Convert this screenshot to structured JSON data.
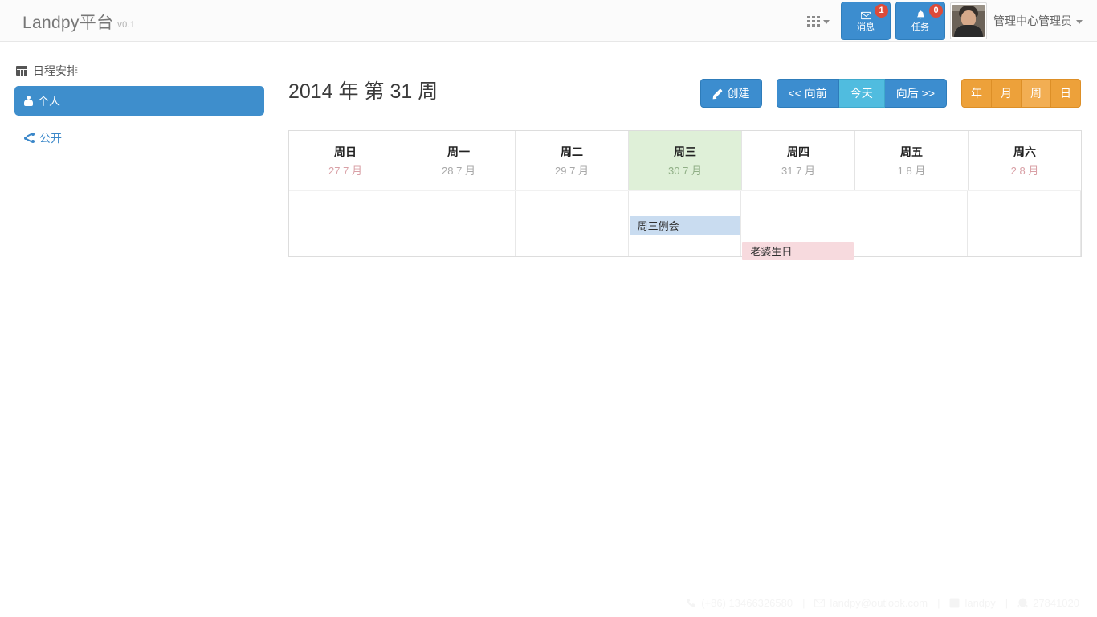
{
  "brand": {
    "name": "Landpy平台",
    "version": "v0.1"
  },
  "header": {
    "apps_icon": "grid-icon",
    "messages": {
      "label": "消息",
      "badge": "1",
      "icon": "envelope-icon"
    },
    "tasks": {
      "label": "任务",
      "badge": "0",
      "icon": "bell-icon"
    },
    "avatar": "user-avatar",
    "user_name": "管理中心管理员"
  },
  "sidebar": {
    "section_title": "日程安排",
    "section_icon": "calendar-icon",
    "items": [
      {
        "label": "个人",
        "icon": "person-icon",
        "active": true
      },
      {
        "label": "公开",
        "icon": "share-icon",
        "active": false
      }
    ]
  },
  "main": {
    "title": "2014 年 第 31 周",
    "toolbar": {
      "create": "创建",
      "prev": "<< 向前",
      "today": "今天",
      "next": "向后 >>",
      "year": "年",
      "month": "月",
      "week": "周",
      "day": "日"
    },
    "calendar": {
      "days": [
        {
          "name": "周日",
          "date": "27 7 月",
          "weekend": true,
          "today": false
        },
        {
          "name": "周一",
          "date": "28 7 月",
          "weekend": false,
          "today": false
        },
        {
          "name": "周二",
          "date": "29 7 月",
          "weekend": false,
          "today": false
        },
        {
          "name": "周三",
          "date": "30 7 月",
          "weekend": false,
          "today": true
        },
        {
          "name": "周四",
          "date": "31 7 月",
          "weekend": false,
          "today": false
        },
        {
          "name": "周五",
          "date": "1 8 月",
          "weekend": false,
          "today": false
        },
        {
          "name": "周六",
          "date": "2 8 月",
          "weekend": true,
          "today": false
        }
      ],
      "events": [
        {
          "title": "周三例会",
          "day_index": 3,
          "color": "blue"
        },
        {
          "title": "老婆生日",
          "day_index": 4,
          "color": "pink"
        }
      ]
    }
  },
  "footer": {
    "phone": "(+86) 13466326580",
    "email": "landpy@outlook.com",
    "blog": "landpy",
    "qq": "27841020",
    "separator": "|"
  },
  "colors": {
    "accent_blue": "#3c8dcf",
    "accent_orange": "#eda13a",
    "badge_red": "#dd4b39",
    "today_green": "#dff0d8",
    "event_blue": "#c9dcf0",
    "event_pink": "#f7dade"
  }
}
